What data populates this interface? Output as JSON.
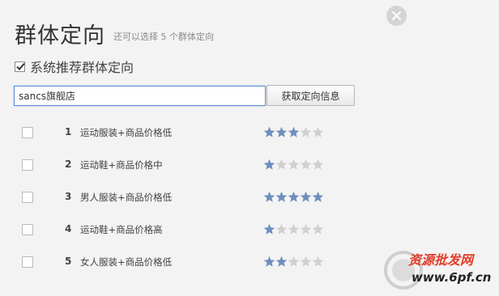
{
  "dialog": {
    "title": "群体定向",
    "subtitle": "还可以选择 5 个群体定向",
    "recommend": {
      "label": "系统推荐群体定向",
      "checked": true
    },
    "search": {
      "value": "sancs旗舰店"
    },
    "fetch_button_label": "获取定向信息",
    "items": [
      {
        "number": "1",
        "label": "运动服装+商品价格低",
        "rating": 3,
        "max_rating": 5
      },
      {
        "number": "2",
        "label": "运动鞋+商品价格中",
        "rating": 1,
        "max_rating": 5
      },
      {
        "number": "3",
        "label": "男人服装+商品价格低",
        "rating": 5,
        "max_rating": 5
      },
      {
        "number": "4",
        "label": "运动鞋+商品价格高",
        "rating": 1,
        "max_rating": 5
      },
      {
        "number": "5",
        "label": "女人服装+商品价格低",
        "rating": 2,
        "max_rating": 5
      }
    ]
  },
  "watermark": {
    "line1": "资源批发网",
    "line2": "www.6pf.cn"
  },
  "colors": {
    "star_filled": "#6f8fbd",
    "star_empty": "#d0d0d0",
    "input_border": "#5a8fd6",
    "watermark_red": "#e23c2a"
  }
}
